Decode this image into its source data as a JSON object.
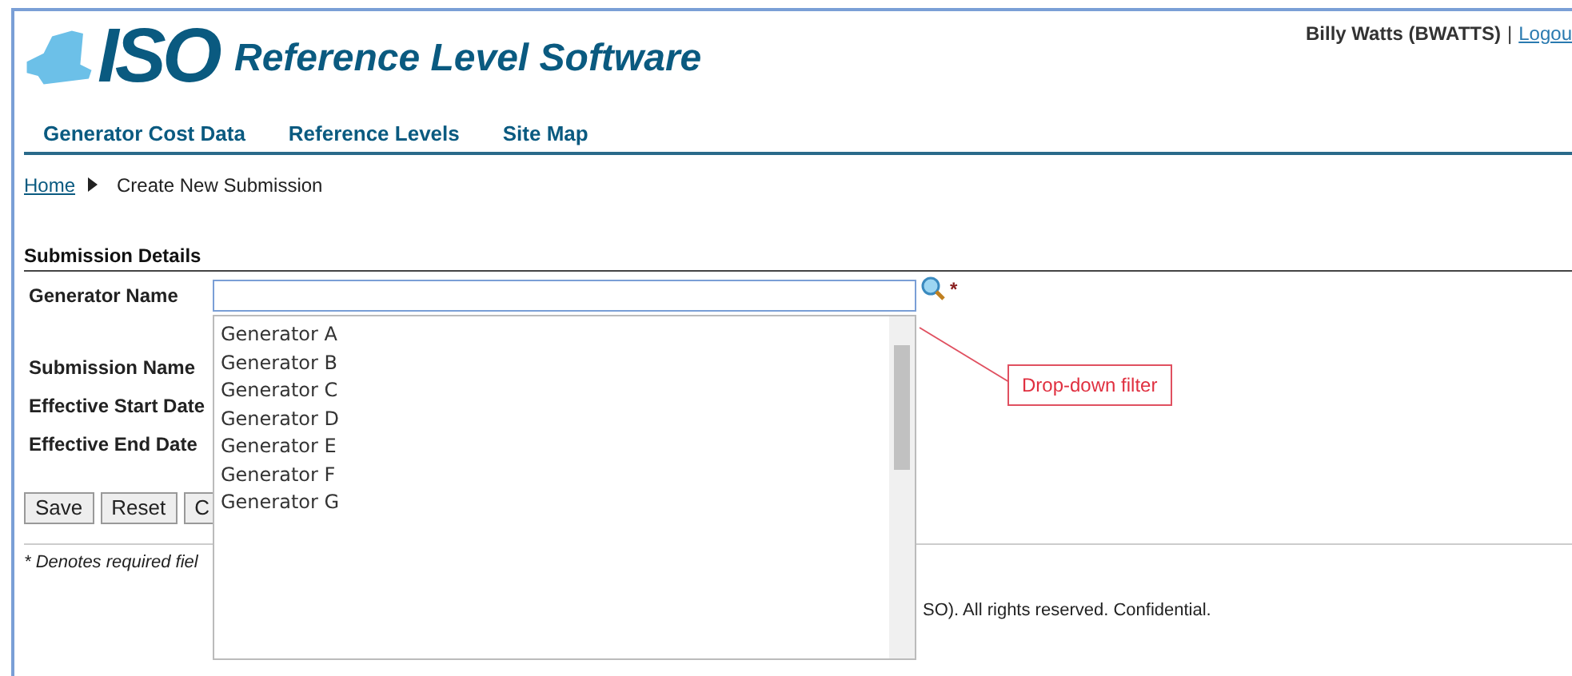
{
  "header": {
    "logo_text": "ISO",
    "app_title": "Reference Level Software",
    "user": "Billy Watts (BWATTS)",
    "separator": "|",
    "logout": "Logou"
  },
  "nav": [
    {
      "label": "Generator Cost Data"
    },
    {
      "label": "Reference Levels"
    },
    {
      "label": "Site Map"
    }
  ],
  "breadcrumb": {
    "home": "Home",
    "current": "Create New Submission"
  },
  "section_title": "Submission Details",
  "fields": [
    {
      "label": "Generator Name",
      "required_mark": "*"
    },
    {
      "label": "Submission Name"
    },
    {
      "label": "Effective Start Date"
    },
    {
      "label": "Effective End Date"
    }
  ],
  "dropdown": {
    "options": [
      "Generator A",
      "Generator B",
      "Generator C",
      "Generator D",
      "Generator E",
      "Generator F",
      "Generator G"
    ]
  },
  "callout": "Drop-down filter",
  "buttons": [
    "Save",
    "Reset",
    "C"
  ],
  "note": "* Denotes required fiel",
  "footer": "SO). All rights reserved. Confidential."
}
